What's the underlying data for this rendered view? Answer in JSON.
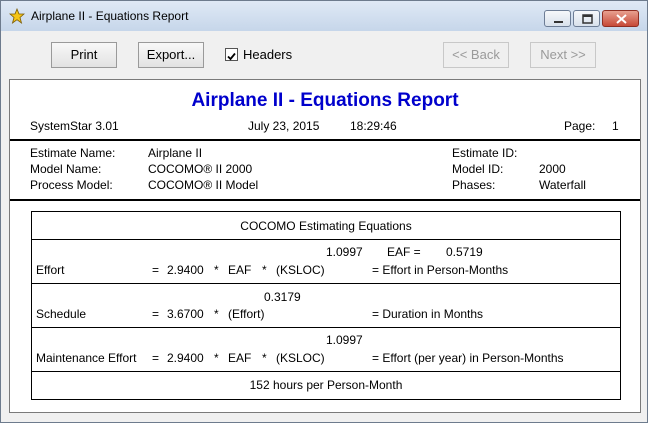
{
  "window": {
    "title": "Airplane II - Equations Report",
    "icons": {
      "app": "star-icon",
      "minimize": "minimize-icon",
      "maximize": "maximize-icon",
      "close": "close-icon"
    },
    "colors": {
      "title_text": "#0000cc"
    }
  },
  "toolbar": {
    "print_label": "Print",
    "export_label": "Export...",
    "headers_label": "Headers",
    "headers_checked": true,
    "back_label": "<< Back",
    "next_label": "Next >>"
  },
  "report": {
    "title": "Airplane II - Equations Report",
    "system": "SystemStar 3.01",
    "date": "July 23, 2015",
    "time": "18:29:46",
    "page_label": "Page:",
    "page_number": "1",
    "info_left": [
      {
        "label": "Estimate Name:",
        "value": "Airplane II"
      },
      {
        "label": "Model Name:",
        "value": "COCOMO® II 2000"
      },
      {
        "label": "Process Model:",
        "value": "COCOMO® II Model"
      }
    ],
    "info_right": [
      {
        "label": "Estimate ID:",
        "value": ""
      },
      {
        "label": "Model ID:",
        "value": "2000"
      },
      {
        "label": "Phases:",
        "value": "Waterfall"
      }
    ],
    "equations": {
      "header": "COCOMO Estimating Equations",
      "effort": {
        "exponent": "1.0997",
        "eaf_label": "EAF =",
        "eaf_value": "0.5719",
        "name": "Effort",
        "eq": "=",
        "coef": "2.9400",
        "op1": "*",
        "term1": "EAF",
        "op2": "*",
        "term2": "(KSLOC)",
        "result": "= Effort in Person-Months"
      },
      "schedule": {
        "exponent": "0.3179",
        "name": "Schedule",
        "eq": "=",
        "coef": "3.6700",
        "op1": "*",
        "term1": "(Effort)",
        "result": "= Duration in Months"
      },
      "maintenance": {
        "exponent": "1.0997",
        "name": "Maintenance Effort",
        "eq": "=",
        "coef": "2.9400",
        "op1": "*",
        "term1": "EAF",
        "op2": "*",
        "term2": "(KSLOC)",
        "result": "= Effort (per year) in Person-Months"
      },
      "footer": "152 hours per Person-Month"
    }
  }
}
